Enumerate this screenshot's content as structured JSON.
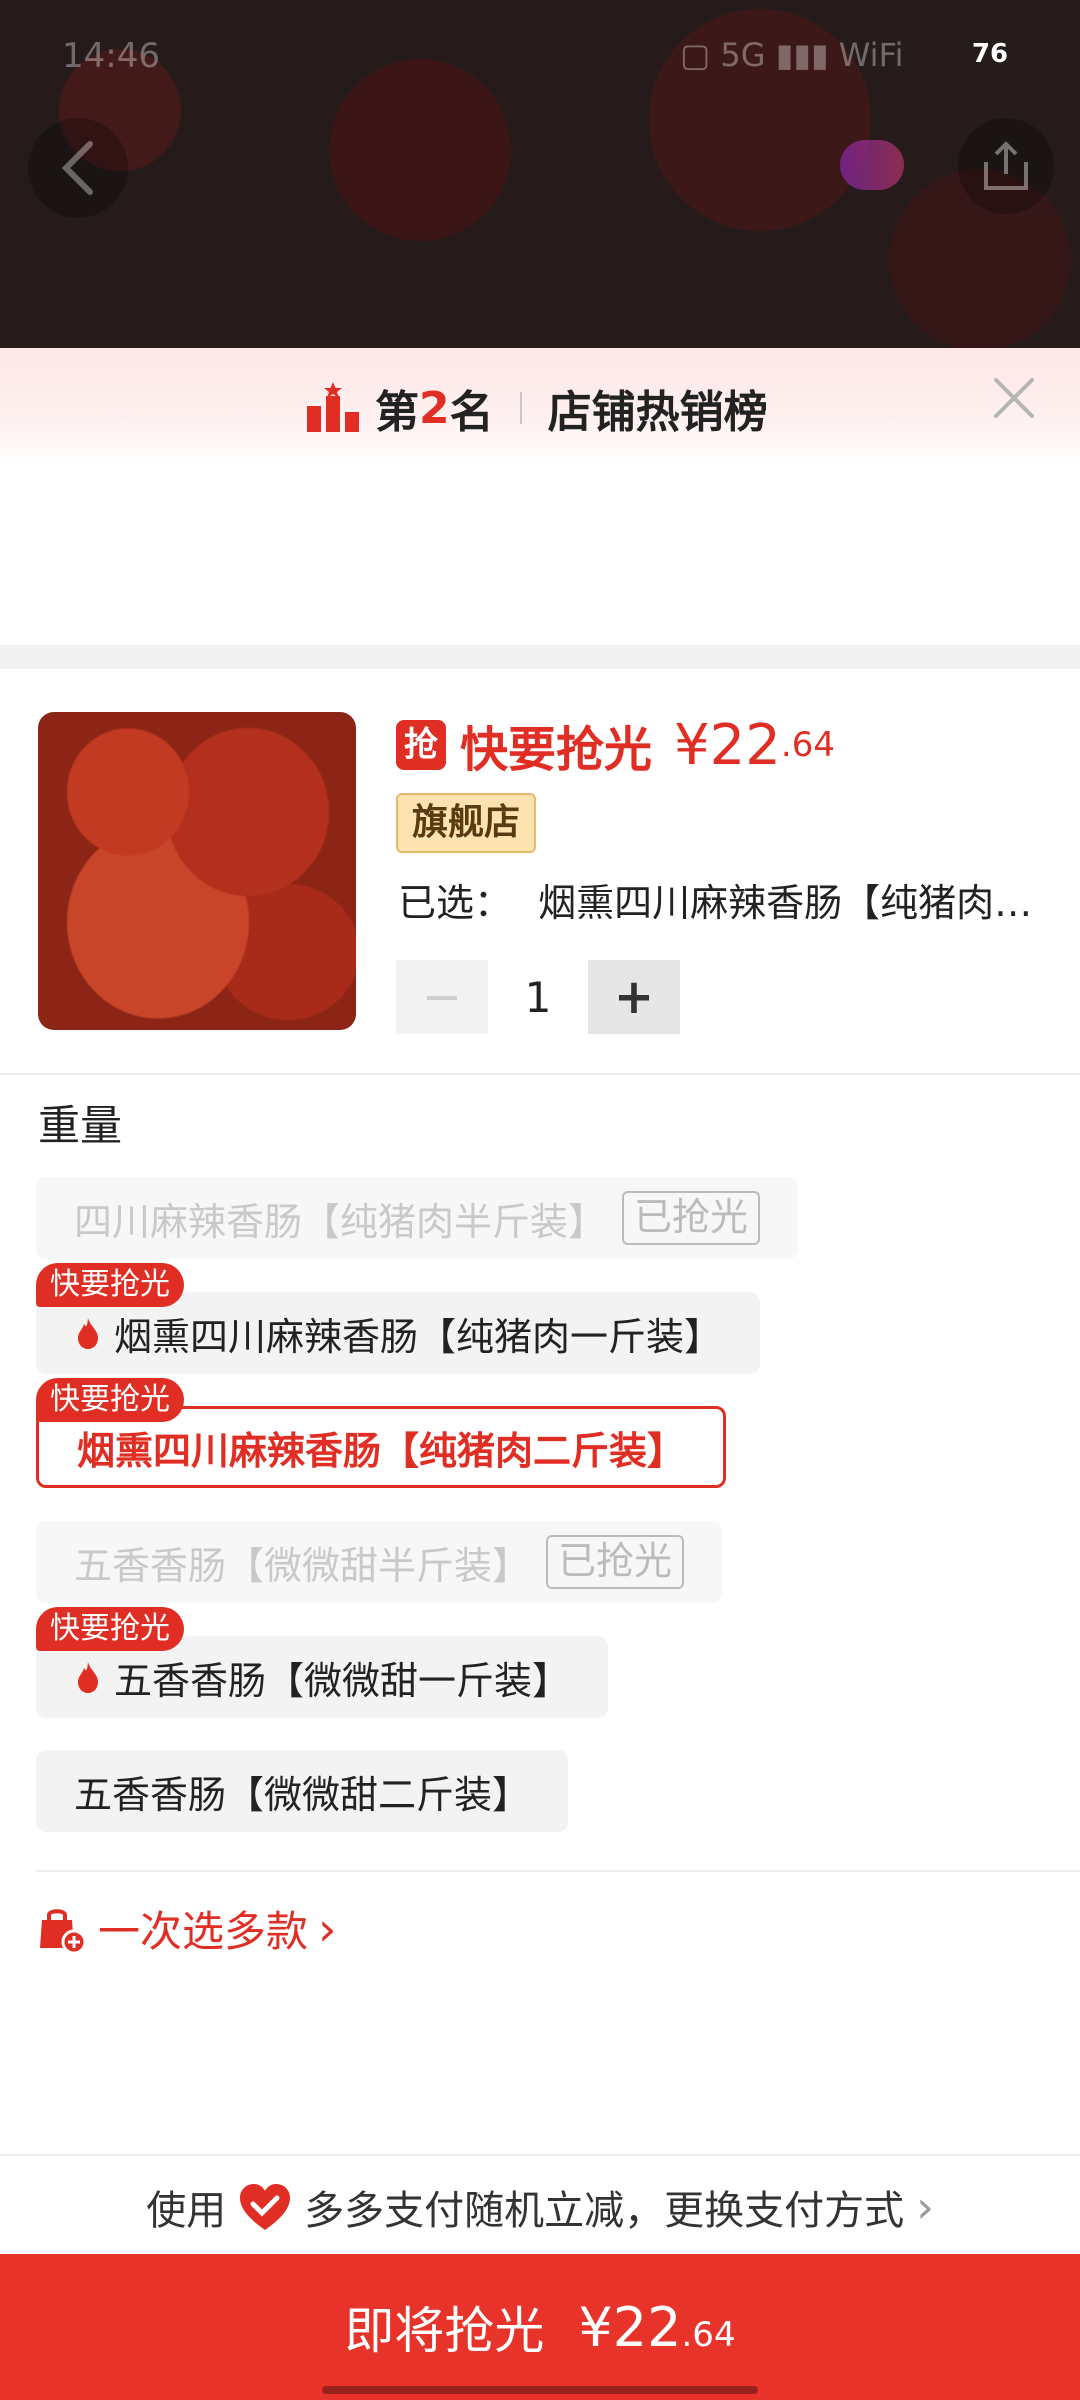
{
  "status_bar": {
    "time": "14:46",
    "indicators": "▢  5G  ▮▮▮  WiFi",
    "battery": "76"
  },
  "header": {
    "back_icon": "back-arrow-icon",
    "share_icon": "share-icon"
  },
  "ranking": {
    "prefix": "第",
    "rank": "2",
    "suffix": "名",
    "list_name": "店铺热销榜"
  },
  "product": {
    "grab_badge": "抢",
    "status": "快要抢光",
    "price_symbol": "¥",
    "price_int": "22",
    "price_dec": ".64",
    "store_tag": "旗舰店",
    "selected_label": "已选：",
    "selected_value": "烟熏四川麻辣香肠【纯猪肉…",
    "quantity": "1",
    "minus": "−",
    "plus": "+"
  },
  "weight": {
    "title": "重量",
    "options": [
      {
        "label": "四川麻辣香肠【纯猪肉半斤装】",
        "sold_out": "已抢光",
        "state": "disabled"
      },
      {
        "label": "烟熏四川麻辣香肠【纯猪肉一斤装】",
        "tag": "快要抢光",
        "state": "normal"
      },
      {
        "label": "烟熏四川麻辣香肠【纯猪肉二斤装】",
        "tag": "快要抢光",
        "state": "selected"
      },
      {
        "label": "五香香肠【微微甜半斤装】",
        "sold_out": "已抢光",
        "state": "disabled"
      },
      {
        "label": "五香香肠【微微甜一斤装】",
        "tag": "快要抢光",
        "state": "normal"
      },
      {
        "label": "五香香肠【微微甜二斤装】",
        "state": "normal"
      }
    ]
  },
  "multi_select": {
    "label": "一次选多款",
    "chevron": "›"
  },
  "payment": {
    "prefix": "使用",
    "method": "多多支付随机立减，更换支付方式",
    "chevron": "›"
  },
  "buy_button": {
    "label": "即将抢光",
    "price_symbol": "¥",
    "price_int": "22",
    "price_dec": ".64"
  },
  "colors": {
    "accent": "#e02e24",
    "button": "#e8332a",
    "tag_bg": "#fde3b0"
  }
}
